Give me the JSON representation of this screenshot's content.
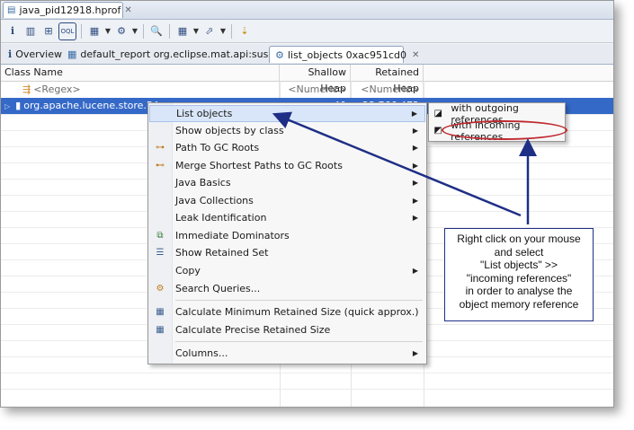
{
  "editor_tab": {
    "title": "java_pid12918.hprof"
  },
  "toolbar": {
    "buttons": [
      "info-icon",
      "histogram-icon",
      "dominator-tree-icon",
      "oql-icon",
      "report-icon",
      "run-query-icon",
      "search-icon",
      "calculator-icon",
      "export-icon",
      "toggle-icon"
    ]
  },
  "subtabs": {
    "overview": "Overview",
    "default_report": "default_report  org.eclipse.mat.api:suspects",
    "list_objects": "list_objects 0xac951cd0"
  },
  "table": {
    "headers": [
      "Class Name",
      "Shallow Heap",
      "Retained Heap"
    ],
    "filter_row": {
      "class_name": "<Regex>",
      "shallow": "<Numeric>",
      "retained": "<Numeric>"
    },
    "selected_row": {
      "class_name": "org.apache.lucene.store.RA",
      "shallow": "40",
      "retained": "23,766,472"
    }
  },
  "context_menu": {
    "items": [
      {
        "label": "List objects",
        "icon": "",
        "submenu": true
      },
      {
        "label": "Show objects by class",
        "icon": "",
        "submenu": true
      },
      {
        "label": "Path To GC Roots",
        "icon": "path-icon",
        "submenu": true
      },
      {
        "label": "Merge Shortest Paths to GC Roots",
        "icon": "merge-paths-icon",
        "submenu": true
      },
      {
        "label": "Java Basics",
        "icon": "",
        "submenu": true
      },
      {
        "label": "Java Collections",
        "icon": "",
        "submenu": true
      },
      {
        "label": "Leak Identification",
        "icon": "",
        "submenu": true
      },
      {
        "label": "Immediate Dominators",
        "icon": "dominators-icon",
        "submenu": false
      },
      {
        "label": "Show Retained Set",
        "icon": "retained-set-icon",
        "submenu": false
      },
      {
        "label": "Copy",
        "icon": "",
        "submenu": true
      },
      {
        "label": "Search Queries...",
        "icon": "search-queries-icon",
        "submenu": false
      },
      {
        "label": "Calculate Minimum Retained Size (quick approx.)",
        "icon": "calculator-icon",
        "submenu": false
      },
      {
        "label": "Calculate Precise Retained Size",
        "icon": "calculator-icon",
        "submenu": false
      },
      {
        "label": "Columns...",
        "icon": "",
        "submenu": true
      }
    ]
  },
  "submenu": {
    "outgoing": "with outgoing references",
    "incoming": "with incoming references"
  },
  "annotation": {
    "callout_text": "Right click on your mouse\nand select\n\"List objects\" >>\n\"incoming references\"\nin order to analyse the\nobject memory reference",
    "arrow_color": "#1f2f86",
    "highlight_color": "#c0282f"
  }
}
